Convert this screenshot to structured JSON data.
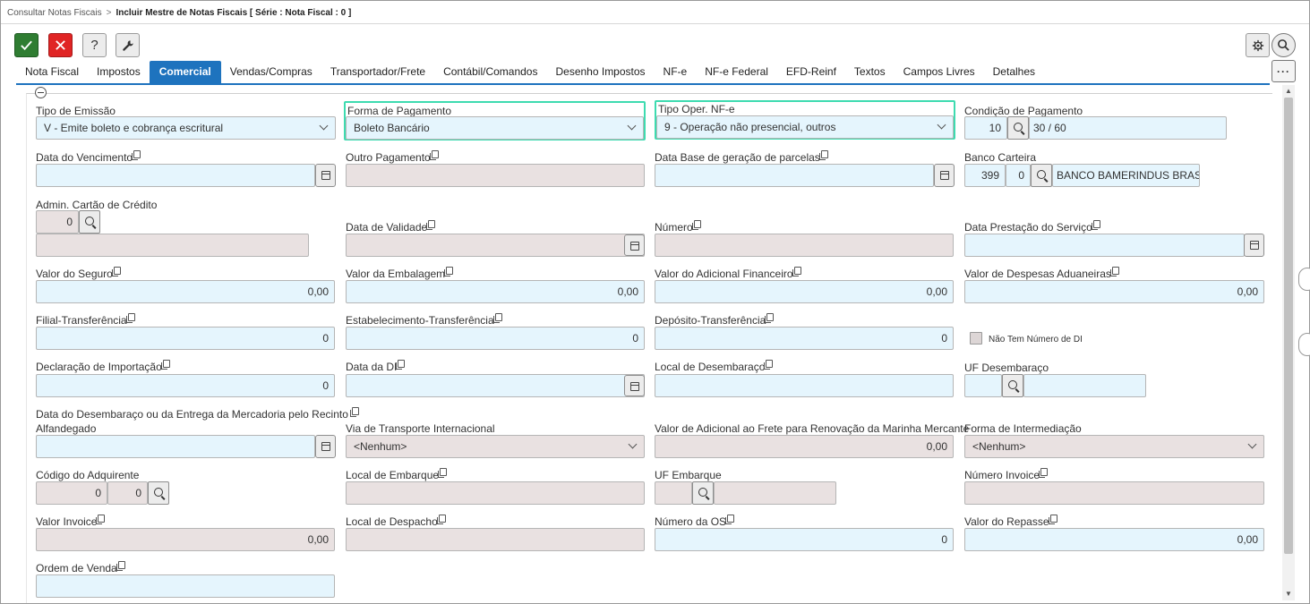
{
  "breadcrumb": {
    "parent": "Consultar Notas Fiscais",
    "separator": ">",
    "current": "Incluir Mestre de Notas Fiscais [ Série : Nota Fiscal : 0 ]"
  },
  "toolbar": {
    "confirm_icon": "check-icon",
    "cancel_icon": "close-icon",
    "help_label": "?",
    "tools_icon": "wrench-icon",
    "settings_icon": "gear-icon",
    "search_icon": "search-icon",
    "more_label": "···"
  },
  "tabs": [
    {
      "label": "Nota Fiscal"
    },
    {
      "label": "Impostos"
    },
    {
      "label": "Comercial",
      "active": true
    },
    {
      "label": "Vendas/Compras"
    },
    {
      "label": "Transportador/Frete"
    },
    {
      "label": "Contábil/Comandos"
    },
    {
      "label": "Desenho Impostos"
    },
    {
      "label": "NF-e"
    },
    {
      "label": "NF-e Federal"
    },
    {
      "label": "EFD-Reinf"
    },
    {
      "label": "Textos"
    },
    {
      "label": "Campos Livres"
    },
    {
      "label": "Detalhes"
    }
  ],
  "form": {
    "tipo_emissao": {
      "label": "Tipo de Emissão",
      "value": "V - Emite boleto e cobrança escritural"
    },
    "forma_pagamento": {
      "label": "Forma de Pagamento",
      "value": "Boleto Bancário"
    },
    "tipo_oper": {
      "label": "Tipo Oper. NF-e",
      "value": "9 - Operação não presencial, outros"
    },
    "condicao_pagamento": {
      "label": "Condição de Pagamento",
      "code": "10",
      "desc": "30 / 60"
    },
    "data_vencimento": {
      "label": "Data do Vencimento",
      "value": ""
    },
    "outro_pagamento": {
      "label": "Outro Pagamento",
      "value": ""
    },
    "data_base": {
      "label": "Data Base de geração de parcelas",
      "value": ""
    },
    "banco_carteira": {
      "label": "Banco Carteira",
      "code": "399",
      "carteira": "0",
      "desc": "BANCO BAMERINDUS BRASIL"
    },
    "admin_cartao": {
      "label": "Admin. Cartão de Crédito",
      "code": "0",
      "desc": ""
    },
    "data_validade": {
      "label": "Data de Validade",
      "value": ""
    },
    "numero": {
      "label": "Número",
      "value": ""
    },
    "data_prestacao": {
      "label": "Data Prestação do Serviço",
      "value": ""
    },
    "valor_seguro": {
      "label": "Valor do Seguro",
      "value": "0,00"
    },
    "valor_embalagem": {
      "label": "Valor da Embalagem",
      "value": "0,00"
    },
    "valor_adicional_fin": {
      "label": "Valor do Adicional Financeiro",
      "value": "0,00"
    },
    "valor_despesas_adu": {
      "label": "Valor de Despesas Aduaneiras",
      "value": "0,00"
    },
    "filial_transf": {
      "label": "Filial-Transferência",
      "value": "0"
    },
    "estab_transf": {
      "label": "Estabelecimento-Transferência",
      "value": "0"
    },
    "deposito_transf": {
      "label": "Depósito-Transferência",
      "value": "0"
    },
    "nao_tem_di": {
      "label": "Não Tem Número de DI"
    },
    "declaracao_import": {
      "label": "Declaração de Importação",
      "value": "0"
    },
    "data_di": {
      "label": "Data da DI",
      "value": ""
    },
    "local_desembaraco": {
      "label": "Local de Desembaraço",
      "value": ""
    },
    "uf_desembaraco": {
      "label": "UF Desembaraço",
      "code": "",
      "desc": ""
    },
    "data_desembaraco": {
      "label_line1": "Data do Desembaraço ou da Entrega da Mercadoria pelo Recinto",
      "label_line2": "Alfandegado",
      "value": ""
    },
    "via_transporte": {
      "label": "Via de Transporte Internacional",
      "value": "<Nenhum>"
    },
    "valor_adicional_frete": {
      "label": "Valor de Adicional ao Frete para Renovação da Marinha Mercante",
      "value": "0,00"
    },
    "forma_intermediacao": {
      "label": "Forma de Intermediação",
      "value": "<Nenhum>"
    },
    "codigo_adquirente": {
      "label": "Código do Adquirente",
      "code1": "0",
      "code2": "0"
    },
    "local_embarque": {
      "label": "Local de Embarque",
      "value": ""
    },
    "uf_embarque": {
      "label": "UF Embarque",
      "code": "",
      "desc": ""
    },
    "numero_invoice": {
      "label": "Número Invoice",
      "value": ""
    },
    "valor_invoice": {
      "label": "Valor Invoice",
      "value": "0,00"
    },
    "local_despacho": {
      "label": "Local de Despacho",
      "value": ""
    },
    "numero_os": {
      "label": "Número da OS",
      "value": "0"
    },
    "valor_repasse": {
      "label": "Valor do Repasse",
      "value": "0,00"
    },
    "ordem_venda": {
      "label": "Ordem de Venda",
      "value": ""
    }
  }
}
